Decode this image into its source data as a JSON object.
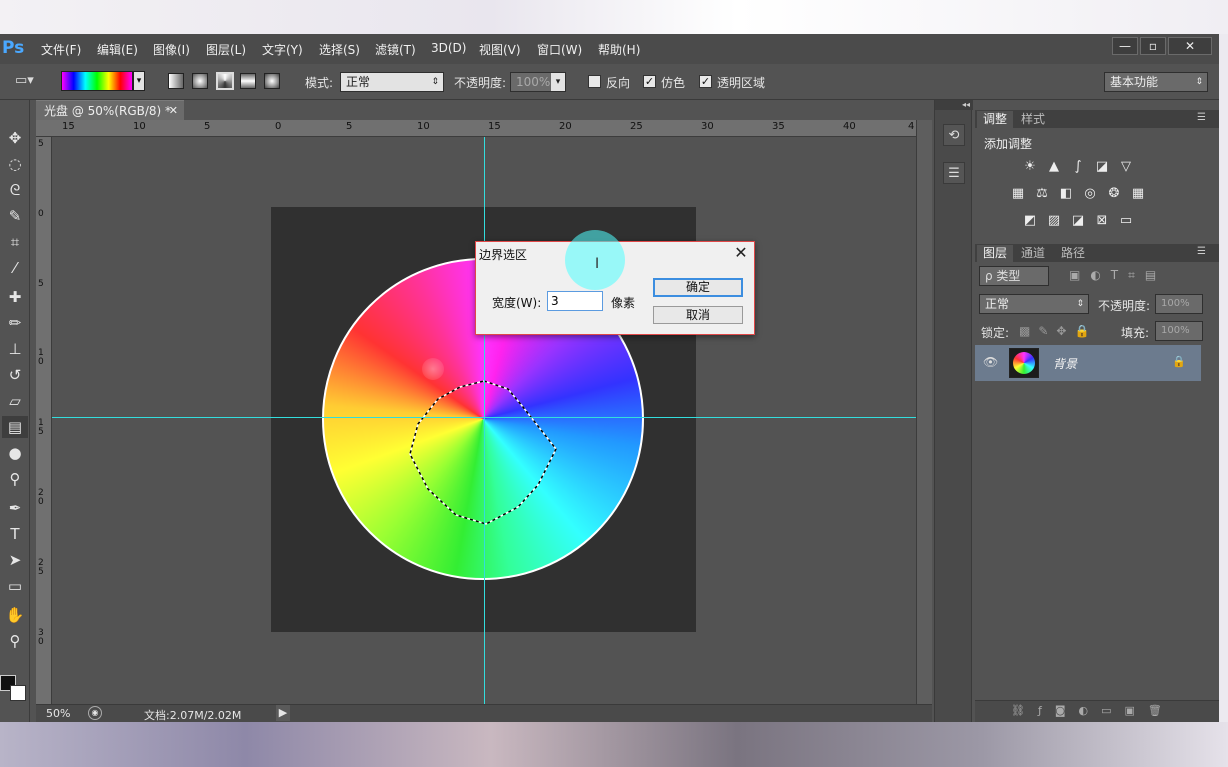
{
  "app": {
    "logo": "Ps"
  },
  "menu": [
    "文件(F)",
    "编辑(E)",
    "图像(I)",
    "图层(L)",
    "文字(Y)",
    "选择(S)",
    "滤镜(T)",
    "3D(D)",
    "视图(V)",
    "窗口(W)",
    "帮助(H)"
  ],
  "window_controls": {
    "minimize": "—",
    "maximize": "▫",
    "close": "✕"
  },
  "options": {
    "mode_label": "模式:",
    "mode_value": "正常",
    "opacity_label": "不透明度:",
    "opacity_value": "100%",
    "reverse_label": "反向",
    "dither_label": "仿色",
    "transparency_label": "透明区域",
    "dither_checked": "✓",
    "transparency_checked": "✓",
    "workspace": "基本功能"
  },
  "document": {
    "tab_title": "光盘 @ 50%(RGB/8) *",
    "ruler_top": [
      "15",
      "10",
      "5",
      "0",
      "5",
      "10",
      "15",
      "20",
      "25",
      "30",
      "35",
      "40",
      "4"
    ],
    "ruler_left": [
      "5",
      "0",
      "5",
      "1\n0",
      "1\n5",
      "2\n0",
      "2\n5",
      "3\n0"
    ]
  },
  "status": {
    "zoom": "50%",
    "doc_info": "文档:2.07M/2.02M"
  },
  "dialog": {
    "title": "边界选区",
    "width_label": "宽度(W):",
    "width_value": "3",
    "unit": "像素",
    "ok": "确定",
    "cancel": "取消"
  },
  "adjustments_panel": {
    "tabs": [
      "调整",
      "样式"
    ],
    "title": "添加调整",
    "icons": [
      "brightness-contrast",
      "levels",
      "curves",
      "exposure",
      "vibrance",
      "hue-saturation",
      "color-balance",
      "black-white",
      "photo-filter",
      "channel-mixer",
      "color-lookup",
      "invert",
      "posterize",
      "threshold",
      "selective-color",
      "gradient-map"
    ]
  },
  "layers_panel": {
    "tabs": [
      "图层",
      "通道",
      "路径"
    ],
    "filter_label": "ρ 类型",
    "blend_mode": "正常",
    "opacity_label": "不透明度:",
    "opacity_value": "100%",
    "lock_label": "锁定:",
    "fill_label": "填充:",
    "fill_value": "100%",
    "layers": [
      {
        "name": "背景",
        "locked": true,
        "visible": true
      }
    ]
  },
  "colors": {
    "guide": "#33dddd",
    "accent": "#4aa8ff",
    "dialog_border": "#e04848"
  }
}
